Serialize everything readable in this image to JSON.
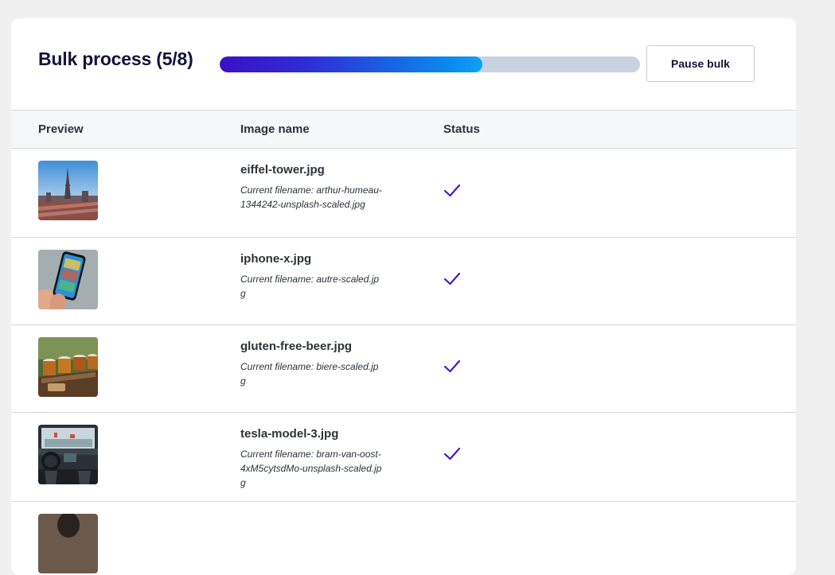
{
  "header": {
    "title": "Bulk process (5/8)",
    "progress_fraction": 0.625,
    "pause_label": "Pause bulk"
  },
  "table": {
    "columns": [
      "Preview",
      "Image name",
      "Status"
    ],
    "rows": [
      {
        "image_name": "eiffel-tower.jpg",
        "current_filename": "Current filename: arthur-humeau-1344242-unsplash-scaled.jpg",
        "status": "done",
        "preview_icon": "eiffel-tower-photo"
      },
      {
        "image_name": "iphone-x.jpg",
        "current_filename": "Current filename: autre-scaled.jpg",
        "status": "done",
        "preview_icon": "iphone-photo"
      },
      {
        "image_name": "gluten-free-beer.jpg",
        "current_filename": "Current filename: biere-scaled.jpg",
        "status": "done",
        "preview_icon": "beer-photo"
      },
      {
        "image_name": "tesla-model-3.jpg",
        "current_filename": "Current filename: bram-van-oost-4xM5cytsdMo-unsplash-scaled.jpg",
        "status": "done",
        "preview_icon": "car-interior-photo"
      }
    ]
  },
  "colors": {
    "accent": "#3a0fc6",
    "progress_end": "#11a0f4",
    "check": "#4a16c9"
  }
}
